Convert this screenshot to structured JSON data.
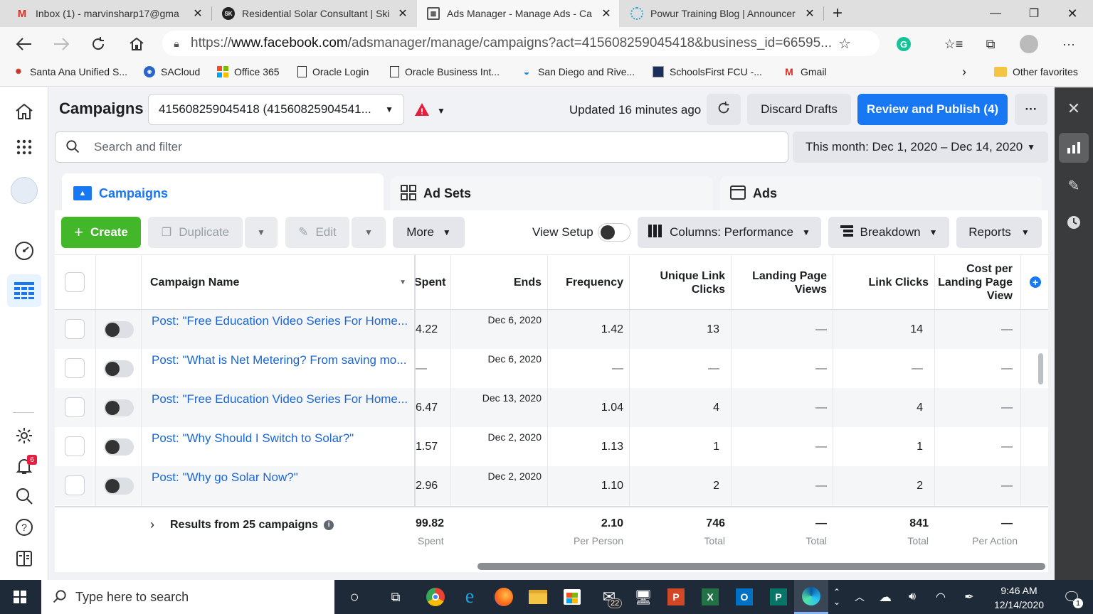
{
  "browser": {
    "tabs": [
      {
        "title": "Inbox (1) - marvinsharp17@gma",
        "icon": "gmail-icon"
      },
      {
        "title": "Residential Solar Consultant | Ski",
        "icon": "sk-icon"
      },
      {
        "title": "Ads Manager - Manage Ads - Ca",
        "icon": "ads-manager-icon",
        "active": true
      },
      {
        "title": "Powur Training Blog | Announcer",
        "icon": "loading-icon"
      }
    ],
    "url_prefix": "https://",
    "url_domain": "www.facebook.com",
    "url_rest": "/adsmanager/manage/campaigns?act=415608259045418&business_id=66595...",
    "favorites": [
      "Santa Ana Unified S...",
      "SACloud",
      "Office 365",
      "Oracle Login",
      "Oracle Business Int...",
      "San Diego and Rive...",
      "SchoolsFirst FCU -...",
      "Gmail"
    ],
    "other_favorites": "Other favorites",
    "colors": {
      "accent": "#1877f2",
      "create_green": "#42b72a"
    }
  },
  "header": {
    "title": "Campaigns",
    "account": "415608259045418 (41560825904541...",
    "updated": "Updated 16 minutes ago",
    "discard": "Discard Drafts",
    "review": "Review and Publish (4)",
    "more_dots": "···"
  },
  "search": {
    "placeholder": "Search and filter",
    "date_range": "This month: Dec 1, 2020 – Dec 14, 2020"
  },
  "levels": {
    "campaigns": "Campaigns",
    "adsets": "Ad Sets",
    "ads": "Ads"
  },
  "toolbar": {
    "create": "Create",
    "duplicate": "Duplicate",
    "edit": "Edit",
    "more": "More",
    "view_setup": "View Setup",
    "columns": "Columns: Performance",
    "breakdown": "Breakdown",
    "reports": "Reports"
  },
  "table": {
    "headers": {
      "name": "Campaign Name",
      "spent": "Spent",
      "ends": "Ends",
      "frequency": "Frequency",
      "unique_link_clicks": "Unique Link Clicks",
      "landing_page_views": "Landing Page Views",
      "link_clicks": "Link Clicks",
      "cost_per_lpv": "Cost per Landing Page View"
    },
    "rows": [
      {
        "name": "Post: \"Free Education Video Series For Home...",
        "spent": "4.22",
        "ends": "Dec 6, 2020",
        "frequency": "1.42",
        "unique": "13",
        "lpv": "—",
        "clicks": "14",
        "cost": "—"
      },
      {
        "name": "Post: \"What is Net Metering? From saving mo...",
        "spent": "—",
        "ends": "Dec 6, 2020",
        "frequency": "—",
        "unique": "—",
        "lpv": "—",
        "clicks": "—",
        "cost": "—"
      },
      {
        "name": "Post: \"Free Education Video Series For Home...",
        "spent": "6.47",
        "ends": "Dec 13, 2020",
        "frequency": "1.04",
        "unique": "4",
        "lpv": "—",
        "clicks": "4",
        "cost": "—"
      },
      {
        "name": "Post: \"Why Should I Switch to Solar?\"",
        "spent": "1.57",
        "ends": "Dec 2, 2020",
        "frequency": "1.13",
        "unique": "1",
        "lpv": "—",
        "clicks": "1",
        "cost": "—"
      },
      {
        "name": "Post: \"Why go Solar Now?\"",
        "spent": "2.96",
        "ends": "Dec 2, 2020",
        "frequency": "1.10",
        "unique": "2",
        "lpv": "—",
        "clicks": "2",
        "cost": "—"
      }
    ],
    "summary": {
      "label": "Results from 25 campaigns",
      "spent": "99.82",
      "spent_sub": "Spent",
      "frequency": "2.10",
      "frequency_sub": "Per Person",
      "unique": "746",
      "unique_sub": "Total",
      "lpv": "—",
      "lpv_sub": "Total",
      "clicks": "841",
      "clicks_sub": "Total",
      "cost": "—",
      "cost_sub": "Per Action"
    }
  },
  "leftnav": {
    "notification_count": "6"
  },
  "taskbar": {
    "search_placeholder": "Type here to search",
    "time": "9:46 AM",
    "date": "12/14/2020",
    "mail_badge": "22",
    "notif_badge": "1"
  }
}
